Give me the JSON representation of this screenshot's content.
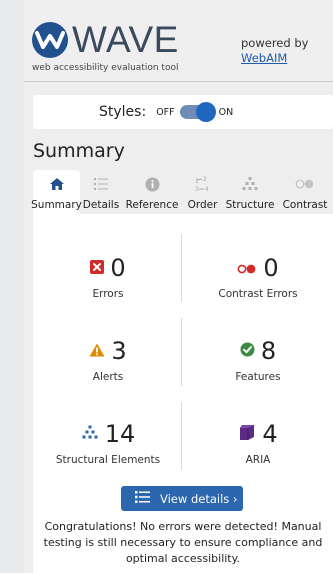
{
  "header": {
    "logo_text": "WAVE",
    "tagline": "web accessibility evaluation tool",
    "powered_by": "powered by",
    "powered_link": "WebAIM"
  },
  "styles_toggle": {
    "label": "Styles:",
    "off_label": "OFF",
    "on_label": "ON",
    "state": "on"
  },
  "section_title": "Summary",
  "tabs": [
    {
      "label": "Summary",
      "icon": "home-icon",
      "active": true
    },
    {
      "label": "Details",
      "icon": "list-icon",
      "active": false
    },
    {
      "label": "Reference",
      "icon": "info-icon",
      "active": false
    },
    {
      "label": "Order",
      "icon": "order-icon",
      "active": false
    },
    {
      "label": "Structure",
      "icon": "structure-icon",
      "active": false
    },
    {
      "label": "Contrast",
      "icon": "contrast-icon",
      "active": false
    }
  ],
  "metrics": {
    "errors": {
      "count": "0",
      "label": "Errors",
      "icon": "error-x-icon",
      "color": "#d22b2b"
    },
    "contrast_errors": {
      "count": "0",
      "label": "Contrast Errors",
      "icon": "contrast-error-icon",
      "color": "#d22b2b"
    },
    "alerts": {
      "count": "3",
      "label": "Alerts",
      "icon": "alert-triangle-icon",
      "color": "#e08a00"
    },
    "features": {
      "count": "8",
      "label": "Features",
      "icon": "feature-check-icon",
      "color": "#3c8a43"
    },
    "structural": {
      "count": "14",
      "label": "Structural Elements",
      "icon": "structure-tree-icon",
      "color": "#2b66ae"
    },
    "aria": {
      "count": "4",
      "label": "ARIA",
      "icon": "aria-cube-icon",
      "color": "#5b2a86"
    }
  },
  "view_details_button": "View details ›",
  "congrats_message": "Congratulations! No errors were detected! Manual testing is still necessary to ensure compliance and optimal accessibility.",
  "colors": {
    "brand_blue": "#22518f",
    "button_blue": "#2b66ae",
    "link_blue": "#1f5da8"
  }
}
